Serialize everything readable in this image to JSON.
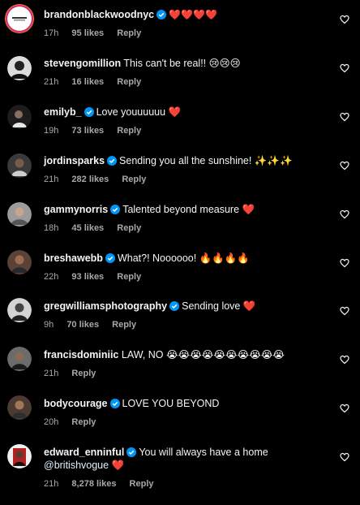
{
  "colors": {
    "background": "#000000",
    "text": "#f5f5f5",
    "muted": "#a8a8a8",
    "verified": "#0095f6"
  },
  "comments": [
    {
      "username": "brandonblackwoodnyc",
      "verified": true,
      "text": "❤️❤️❤️❤️",
      "time": "17h",
      "likes": "95 likes",
      "reply": "Reply",
      "avatar_icon": "avatar-logo-icon"
    },
    {
      "username": "stevengomillion",
      "verified": false,
      "text": "This can't be real!! 😢😢😢",
      "time": "21h",
      "likes": "16 likes",
      "reply": "Reply",
      "avatar_icon": "avatar-photo-icon"
    },
    {
      "username": "emilyb_",
      "verified": true,
      "text": "Love youuuuuu ❤️",
      "time": "19h",
      "likes": "73 likes",
      "reply": "Reply",
      "avatar_icon": "avatar-photo-icon"
    },
    {
      "username": "jordinsparks",
      "verified": true,
      "text": "Sending you all the sunshine! ✨✨✨",
      "time": "21h",
      "likes": "282 likes",
      "reply": "Reply",
      "avatar_icon": "avatar-photo-icon"
    },
    {
      "username": "gammynorris",
      "verified": true,
      "text": "Talented beyond measure ❤️",
      "time": "18h",
      "likes": "45 likes",
      "reply": "Reply",
      "avatar_icon": "avatar-photo-icon"
    },
    {
      "username": "breshawebb",
      "verified": true,
      "text": "What?! Noooooo! 🔥🔥🔥🔥",
      "time": "22h",
      "likes": "93 likes",
      "reply": "Reply",
      "avatar_icon": "avatar-photo-icon"
    },
    {
      "username": "gregwilliamsphotography",
      "verified": true,
      "text": "Sending love ❤️",
      "time": "9h",
      "likes": "70 likes",
      "reply": "Reply",
      "avatar_icon": "avatar-photo-icon"
    },
    {
      "username": "francisdominiic",
      "verified": false,
      "text": "LAW, NO 😭😭😭😭😭😭😭😭😭😭",
      "time": "21h",
      "likes": "",
      "reply": "Reply",
      "avatar_icon": "avatar-photo-icon"
    },
    {
      "username": "bodycourage",
      "verified": true,
      "text": "LOVE YOU BEYOND",
      "time": "20h",
      "likes": "",
      "reply": "Reply",
      "avatar_icon": "avatar-photo-icon"
    },
    {
      "username": "edward_enninful",
      "verified": true,
      "text": "You will always have a home",
      "mention": "@britishvogue",
      "text_after": "❤️",
      "time": "21h",
      "likes": "8,278 likes",
      "reply": "Reply",
      "avatar_icon": "avatar-photo-icon"
    }
  ]
}
